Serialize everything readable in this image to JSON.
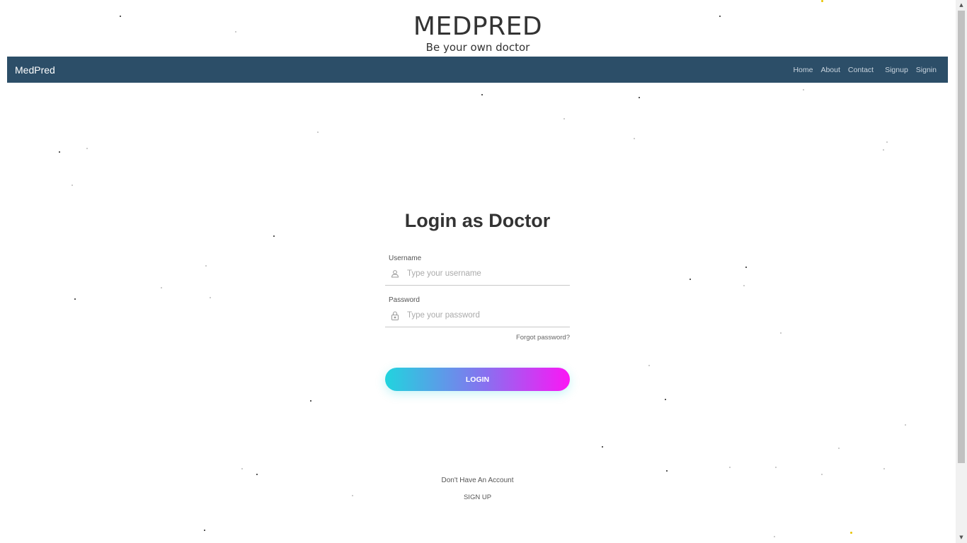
{
  "site": {
    "title": "MEDPRED",
    "tagline": "Be your own doctor"
  },
  "navbar": {
    "brand": "MedPred",
    "links": [
      "Home",
      "About",
      "Contact",
      "Signup",
      "Signin"
    ],
    "background": "#2c4e68"
  },
  "login": {
    "heading": "Login as Doctor",
    "username_label": "Username",
    "username_placeholder": "Type your username",
    "username_icon": "user-icon",
    "password_label": "Password",
    "password_placeholder": "Type your password",
    "password_icon": "lock-icon",
    "forgot": "Forgot password?",
    "button": "LOGIN",
    "button_gradient": [
      "#21d4de",
      "#fc16f5"
    ]
  },
  "footer": {
    "no_account": "Don't Have An Account",
    "signup": "SIGN UP"
  }
}
